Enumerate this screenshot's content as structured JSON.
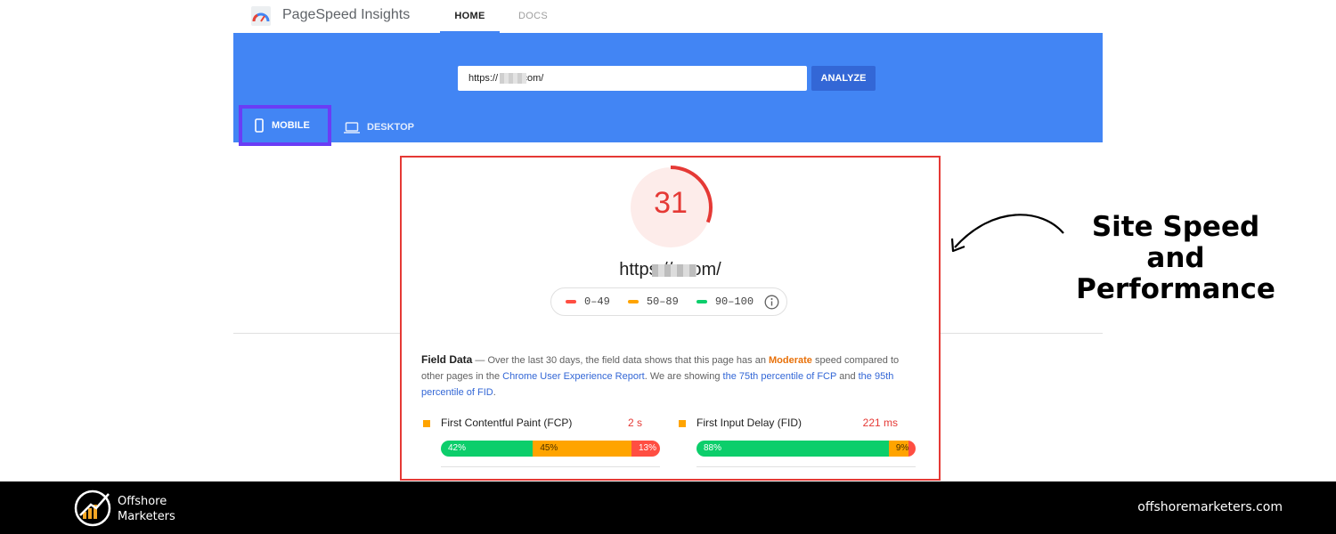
{
  "app": {
    "title": "PageSpeed Insights",
    "logo_icon": "pagespeed-gauge-icon"
  },
  "nav": {
    "tabs": [
      {
        "label": "HOME",
        "active": true
      },
      {
        "label": "DOCS",
        "active": false
      }
    ]
  },
  "hero": {
    "url_value": "https://        .com/",
    "analyze_label": "ANALYZE",
    "device_tabs": [
      {
        "label": "MOBILE",
        "icon": "phone-icon",
        "active": true
      },
      {
        "label": "DESKTOP",
        "icon": "laptop-icon",
        "active": false
      }
    ]
  },
  "result": {
    "score": "31",
    "score_fraction": 0.31,
    "tested_url": "https://        .com/",
    "legend": [
      {
        "label": "0–49",
        "color": "#ff4e42"
      },
      {
        "label": "50–89",
        "color": "#ffa400"
      },
      {
        "label": "90–100",
        "color": "#0cce6b"
      }
    ],
    "info_icon": "info-icon"
  },
  "field_data": {
    "title": "Field Data",
    "intro_1": " — Over the last 30 days, the field data shows that this page has an ",
    "speed_word": "Moderate",
    "intro_2": " speed compared to other pages in the ",
    "report_link": "Chrome User Experience Report",
    "intro_3": ". We are showing ",
    "fcp_link": "the 75th percentile of FCP",
    "intro_4": " and ",
    "fid_link": "the 95th percentile of FID",
    "intro_5": ".",
    "metrics": [
      {
        "name": "First Contentful Paint (FCP)",
        "value": "2 s",
        "segments": [
          {
            "label": "42%",
            "pct": 42
          },
          {
            "label": "45%",
            "pct": 45
          },
          {
            "label": "13%",
            "pct": 13
          }
        ]
      },
      {
        "name": "First Input Delay (FID)",
        "value": "221 ms",
        "segments": [
          {
            "label": "88%",
            "pct": 88
          },
          {
            "label": "9%",
            "pct": 9
          },
          {
            "label": "3%",
            "pct": 3
          }
        ]
      }
    ]
  },
  "annotation": {
    "line1": "Site Speed",
    "line2": "and",
    "line3": "Performance"
  },
  "footer": {
    "brand_line1": "Offshore",
    "brand_line2": "Marketers",
    "url": "offshoremarketers.com"
  },
  "colors": {
    "hero_blue": "#4285f4",
    "highlight_red": "#e53935",
    "highlight_purple": "#6a3df5",
    "good": "#0cce6b",
    "average": "#ffa400",
    "poor": "#ff4e42"
  }
}
